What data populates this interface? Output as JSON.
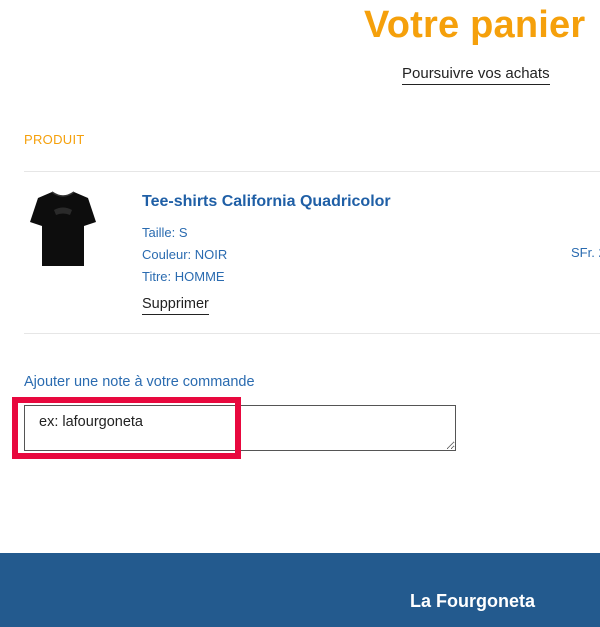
{
  "header": {
    "title": "Votre panier",
    "continue_shopping": "Poursuivre vos achats"
  },
  "cart": {
    "column_header": "PRODUIT",
    "items": [
      {
        "image_icon": "tshirt-icon",
        "title": "Tee-shirts California Quadricolor",
        "variants": {
          "size": "Taille: S",
          "color": "Couleur: NOIR",
          "fit": "Titre: HOMME"
        },
        "remove_label": "Supprimer",
        "price": "SFr. 2"
      }
    ]
  },
  "note": {
    "label": "Ajouter une note à votre commande",
    "placeholder": "ex: lafourgoneta",
    "value": ""
  },
  "footer": {
    "brand": "La Fourgoneta"
  },
  "colors": {
    "accent_orange": "#f5a00b",
    "link_blue": "#1f5fa6",
    "footer_blue": "#235a8e",
    "highlight_red": "#e8083e"
  }
}
